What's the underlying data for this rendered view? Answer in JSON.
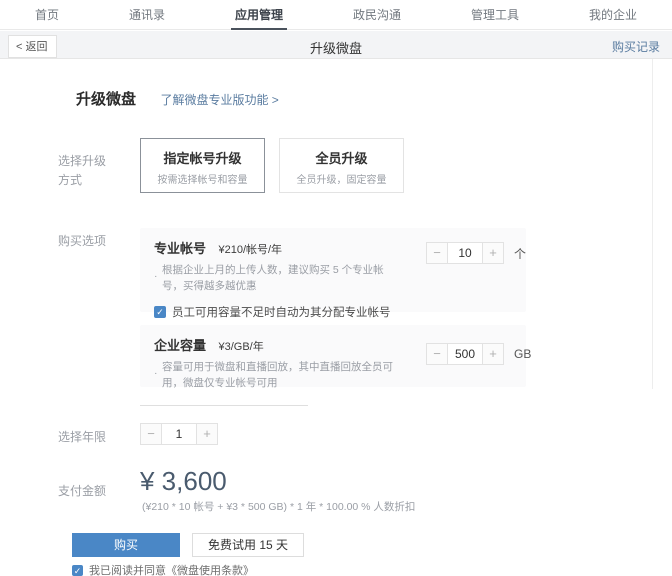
{
  "nav": {
    "tabs": [
      {
        "label": "首页"
      },
      {
        "label": "通讯录"
      },
      {
        "label": "应用管理",
        "active": true
      },
      {
        "label": "政民沟通"
      },
      {
        "label": "管理工具"
      },
      {
        "label": "我的企业"
      }
    ]
  },
  "header": {
    "back_label": "< 返回",
    "title": "升级微盘",
    "purchase_history": "购买记录"
  },
  "intro": {
    "section_title": "升级微盘",
    "learn_more": "了解微盘专业版功能 >"
  },
  "upgrade_mode": {
    "label": "选择升级方式",
    "options": [
      {
        "title": "指定帐号升级",
        "desc": "按需选择帐号和容量",
        "selected": true
      },
      {
        "title": "全员升级",
        "desc": "全员升级，固定容量",
        "selected": false
      }
    ]
  },
  "purchase_options": {
    "label": "购买选项",
    "account": {
      "title": "专业帐号",
      "price": "¥210/帐号/年",
      "note": "根据企业上月的上传人数，建议购买 5 个专业帐号，买得越多越优惠",
      "quantity": "10",
      "unit": "个",
      "auto_assign_label": "员工可用容量不足时自动为其分配专业帐号",
      "auto_assign_checked": true
    },
    "capacity": {
      "title": "企业容量",
      "price": "¥3/GB/年",
      "note": "容量可用于微盘和直播回放，其中直播回放全员可用，微盘仅专业帐号可用",
      "quantity": "500",
      "unit": "GB"
    }
  },
  "years": {
    "label": "选择年限",
    "quantity": "1"
  },
  "payment": {
    "label": "支付金额",
    "amount": "¥ 3,600",
    "formula": "(¥210 * 10 帐号 + ¥3 * 500 GB) * 1 年 * 100.00 % 人数折扣"
  },
  "actions": {
    "buy_label": "购买",
    "trial_label": "免费试用 15 天",
    "agree_label": "我已阅读并同意《微盘使用条款》",
    "agree_checked": true
  },
  "stepper": {
    "minus": "−",
    "plus": "+"
  },
  "icons": {
    "check": "✓"
  },
  "colors": {
    "accent_blue": "#4a87c6",
    "link_blue": "#5a7ca0",
    "price_text": "#4a5b6e",
    "active_tab_underline": "#4a525c",
    "subheader_bg": "#f3f4f6",
    "panel_bg": "#fafafb"
  }
}
